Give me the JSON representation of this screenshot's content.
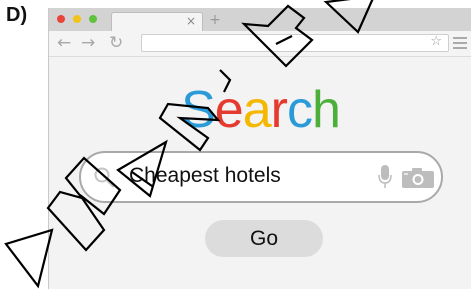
{
  "figure_label": "D)",
  "browser": {
    "tab": {
      "close_glyph": "×",
      "new_tab_glyph": "+"
    },
    "nav": {
      "back_glyph": "←",
      "forward_glyph": "→",
      "reload_glyph": "↻"
    },
    "address_bar": {
      "value": "",
      "bookmark_glyph": "☆"
    },
    "window_controls_colors": [
      "#e8443a",
      "#f2c31a",
      "#61c23d"
    ]
  },
  "search_page": {
    "logo_letters": [
      {
        "char": "S",
        "color": "#2b9bd8"
      },
      {
        "char": "e",
        "color": "#e53a2f"
      },
      {
        "char": "a",
        "color": "#f5b800"
      },
      {
        "char": "r",
        "color": "#e53a2f"
      },
      {
        "char": "c",
        "color": "#2b9bd8"
      },
      {
        "char": "h",
        "color": "#4caf3a"
      }
    ],
    "search_query": "Cheapest hotels",
    "go_label": "Go",
    "icons": [
      "search-icon",
      "mic-icon",
      "camera-icon"
    ]
  },
  "watermark": {
    "text": "AMAZ_BA",
    "color": "#000000"
  }
}
